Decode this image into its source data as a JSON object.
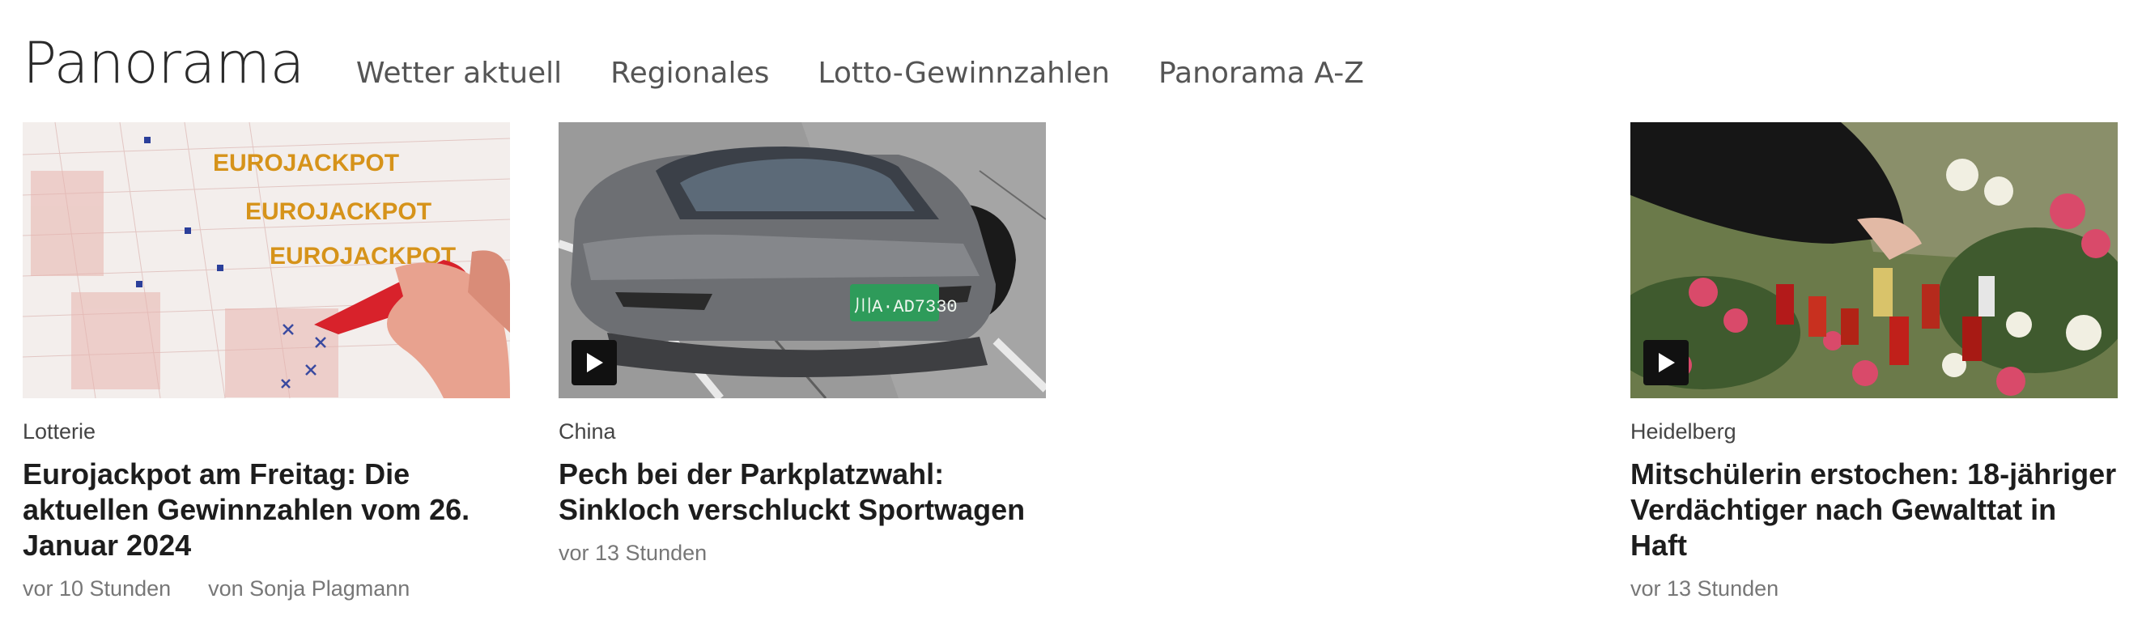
{
  "section": {
    "title": "Panorama",
    "nav": [
      {
        "label": "Wetter aktuell"
      },
      {
        "label": "Regionales"
      },
      {
        "label": "Lotto-Gewinnzahlen"
      },
      {
        "label": "Panorama A-Z"
      }
    ]
  },
  "teasers": [
    {
      "kicker": "Lotterie",
      "headline": "Eurojackpot am Freitag: Die aktuellen Gewinnzahlen vom 26. Januar 2024",
      "time": "vor 10 Stunden",
      "author": "von Sonja Plagmann",
      "image_text": [
        "EUROJACKPOT",
        "EUROJACKPOT",
        "EUROJACKPOT"
      ],
      "is_video": false
    },
    {
      "kicker": "China",
      "headline": "Pech bei der Parkplatzwahl: Sinkloch verschluckt Sportwagen",
      "time": "vor 13 Stunden",
      "plate": "川A·AD7330",
      "is_video": true
    },
    {
      "kicker": "Heidelberg",
      "headline": "Mitschülerin erstochen: 18-jähriger Verdächtiger nach Gewalttat in Haft",
      "time": "vor 13 Stunden",
      "is_video": true
    }
  ],
  "colors": {
    "play_button": "#111111",
    "headline": "#1d1d1d",
    "meta": "#777777"
  }
}
